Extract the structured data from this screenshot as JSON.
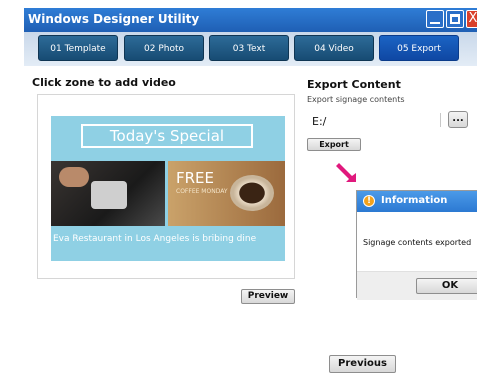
{
  "window": {
    "title": "Windows Designer Utility",
    "close_glyph": "X"
  },
  "tabs": [
    {
      "label": "01 Template",
      "active": false
    },
    {
      "label": "02 Photo",
      "active": false
    },
    {
      "label": "03 Text",
      "active": false
    },
    {
      "label": "04 Video",
      "active": false
    },
    {
      "label": "05 Export",
      "active": true
    }
  ],
  "left": {
    "heading": "Click zone to add video",
    "preview_card": {
      "headline": "Today's Special",
      "promo_title": "FREE",
      "promo_sub": "COFFEE MONDAY",
      "ticker": "Eva Restaurant in Los Angeles is bribing dine"
    },
    "preview_button": "Preview"
  },
  "export": {
    "heading": "Export Content",
    "subheading": "Export signage contents",
    "path_value": "E:/",
    "browse_label": "...",
    "export_button": "Export"
  },
  "dialog": {
    "title": "Information",
    "message": "Signage contents exported",
    "ok_label": "OK"
  },
  "footer": {
    "previous_button": "Previous"
  },
  "colors": {
    "accent": "#1f5fb4",
    "arrow": "#e0197d",
    "card_bg": "#8fd0e4",
    "info_icon": "#f3a21c"
  },
  "icons": [
    "minimize-icon",
    "maximize-icon",
    "close-icon",
    "info-icon",
    "pointer-arrow-icon"
  ]
}
